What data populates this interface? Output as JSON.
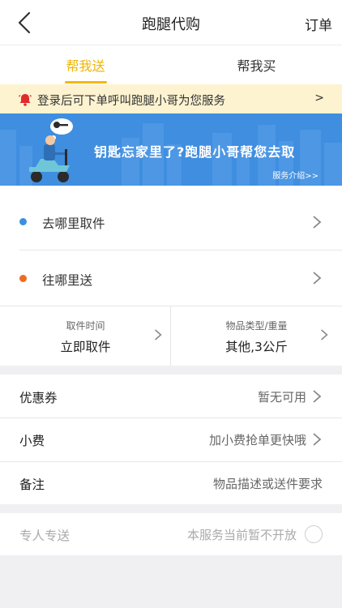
{
  "header": {
    "title": "跑腿代购",
    "orders_label": "订单"
  },
  "tabs": [
    {
      "label": "帮我送",
      "active": true
    },
    {
      "label": "帮我买",
      "active": false
    }
  ],
  "notice": {
    "text": "登录后可下单呼叫跑腿小哥为您服务",
    "arrow": ">"
  },
  "banner": {
    "slogan": "钥匙忘家里了?跑腿小哥帮您去取",
    "link": "服务介绍>>"
  },
  "address": {
    "pickup_label": "去哪里取件",
    "deliver_label": "往哪里送",
    "pickup_dot_color": "#3b8fe0",
    "deliver_dot_color": "#f06a22"
  },
  "details": {
    "pickup_time_label": "取件时间",
    "pickup_time_value": "立即取件",
    "item_label": "物品类型/重量",
    "item_value": "其他,3公斤"
  },
  "options": {
    "coupon_label": "优惠券",
    "coupon_value": "暂无可用",
    "tip_label": "小费",
    "tip_value": "加小费抢单更快哦",
    "note_label": "备注",
    "note_placeholder": "物品描述或送件要求"
  },
  "exclusive": {
    "label": "专人专送",
    "status": "本服务当前暂不开放"
  },
  "colors": {
    "accent": "#f5b800",
    "banner": "#3f8ee0",
    "notice_bg": "#fdf3d0"
  }
}
